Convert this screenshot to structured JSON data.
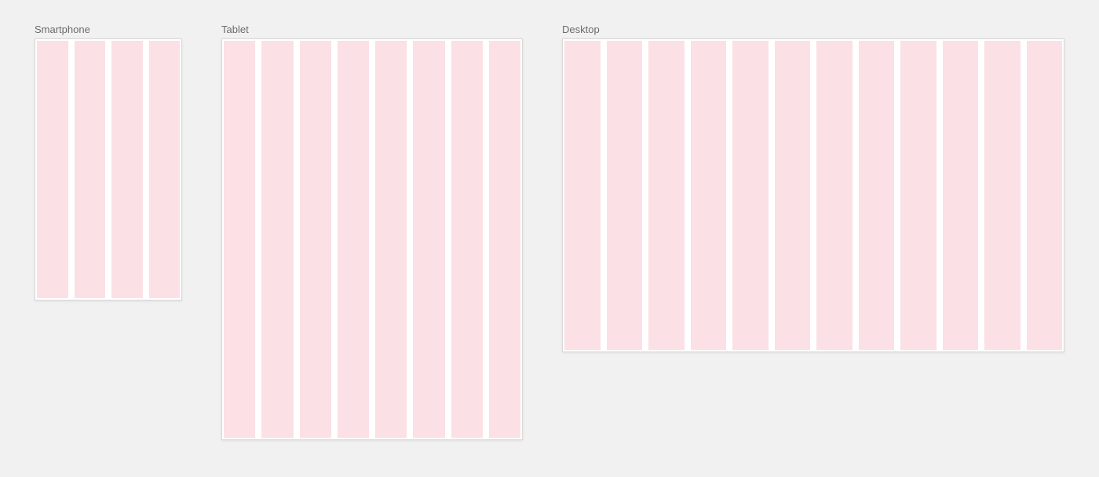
{
  "devices": {
    "smartphone": {
      "label": "Smartphone",
      "columns": 4
    },
    "tablet": {
      "label": "Tablet",
      "columns": 8
    },
    "desktop": {
      "label": "Desktop",
      "columns": 12
    }
  },
  "colors": {
    "column_fill": "#fbe0e6",
    "frame_bg": "#ffffff",
    "page_bg": "#f1f1f1",
    "label_color": "#6b6b6b"
  }
}
